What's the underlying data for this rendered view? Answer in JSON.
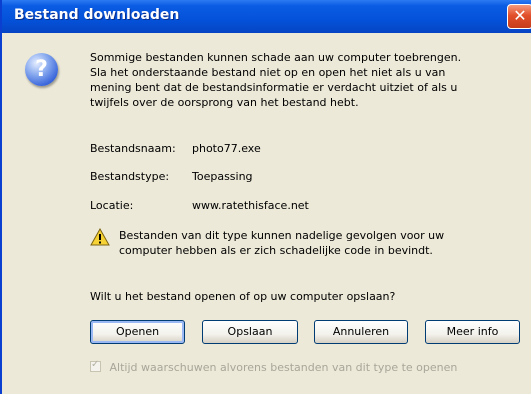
{
  "window": {
    "title": "Bestand downloaden",
    "close_glyph": "✕"
  },
  "icons": {
    "help": "question-icon",
    "warning": "warning-icon"
  },
  "message": {
    "line1": "Sommige bestanden kunnen schade aan uw computer toebrengen.",
    "line2": "Sla het onderstaande bestand niet op en open het niet als u van",
    "line3": "mening bent dat de bestandsinformatie er verdacht uitziet of als u",
    "line4": "twijfels over de oorsprong van het bestand hebt."
  },
  "file_info": {
    "name_label": "Bestandsnaam:",
    "name_value": "photo77.exe",
    "type_label": "Bestandstype:",
    "type_value": "Toepassing",
    "location_label": "Locatie:",
    "location_value": "www.ratethisface.net"
  },
  "warning": {
    "line1": "Bestanden van dit type kunnen nadelige gevolgen voor uw",
    "line2": "computer hebben als er zich schadelijke code in bevindt."
  },
  "question": "Wilt u het bestand openen of op uw computer opslaan?",
  "buttons": {
    "open": "Openen",
    "save": "Opslaan",
    "cancel": "Annuleren",
    "more_info": "Meer info"
  },
  "always_warn": {
    "label": "Altijd waarschuwen alvorens bestanden van dit type te openen",
    "checked": true
  },
  "colors": {
    "titlebar": "#0452D9",
    "dialog_bg": "#ECE9D8",
    "close_button": "#E2502B"
  }
}
